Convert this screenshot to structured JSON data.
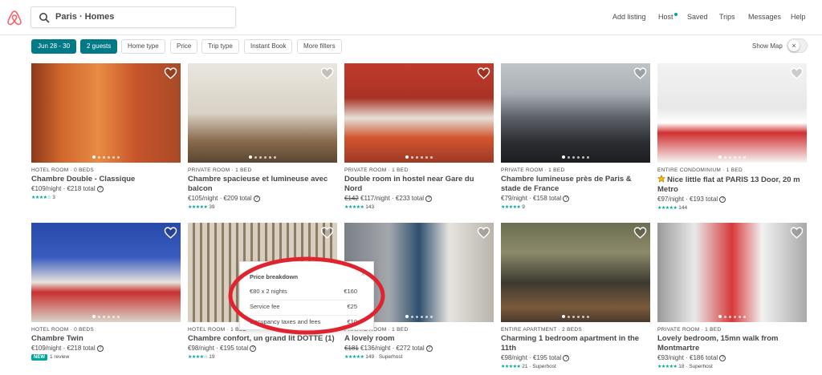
{
  "header": {
    "search_value": "Paris · Homes",
    "nav": [
      "Add listing",
      "Host",
      "Saved",
      "Trips",
      "Messages",
      "Help"
    ]
  },
  "filters": {
    "chips": [
      "Jun 28 - 30",
      "2 guests",
      "Home type",
      "Price",
      "Trip type",
      "Instant Book",
      "More filters"
    ],
    "show_map": "Show Map",
    "toggle_icon": "×"
  },
  "colors": {
    "brand": "#ff5a5f",
    "accent": "#007a87",
    "rating": "#00a699",
    "ellipse": "#e0232f"
  },
  "listings": [
    {
      "kind": "HOTEL ROOM · 0 BEDS",
      "title": "Chambre Double - Classique",
      "price": "€109/night · €218 total",
      "rating_stars": 4,
      "reviews": "3",
      "photo": "orange-hotel"
    },
    {
      "kind": "PRIVATE ROOM · 1 BED",
      "title": "Chambre spacieuse et lumineuse avec balcon",
      "price": "€105/night · €209 total",
      "rating_stars": 5,
      "reviews": "39",
      "photo": "bright-room"
    },
    {
      "kind": "PRIVATE ROOM · 1 BED",
      "title": "Double room in hostel near Gare du Nord",
      "price_old": "€142",
      "price": "€117/night · €233 total",
      "rating_stars": 5,
      "reviews": "143",
      "photo": "red-hostel"
    },
    {
      "kind": "PRIVATE ROOM · 1 BED",
      "title": "Chambre lumineuse près de Paris & stade de France",
      "price": "€79/night · €158 total",
      "rating_stars": 5,
      "reviews": "9",
      "photo": "patterned-bed"
    },
    {
      "kind": "ENTIRE CONDOMINIUM · 1 BED",
      "title": "Nice little flat at PARIS 13 Door, 20 m Metro",
      "price": "€97/night · €193 total",
      "rating_stars": 5,
      "reviews": "144",
      "photo": "white-flat",
      "superhost_star": true
    },
    {
      "kind": "HOTEL ROOM · 0 BEDS",
      "title": "Chambre Twin",
      "price": "€109/night · €218 total",
      "badge": "NEW",
      "reviews": "1 review",
      "photo": "blue-twin"
    },
    {
      "kind": "HOTEL ROOM · 1 BED",
      "title": "Chambre confort, un grand lit DOTTE (1)",
      "price": "€98/night · €195 total",
      "rating_stars": 4,
      "reviews": "19",
      "photo": "striped-room"
    },
    {
      "kind": "PRIVATE ROOM · 1 BED",
      "title": "A lovely room",
      "price_old": "€181",
      "price": "€136/night · €272 total",
      "rating_stars": 5,
      "reviews": "149 · Superhost",
      "photo": "collage"
    },
    {
      "kind": "ENTIRE APARTMENT · 2 BEDS",
      "title": "Charming 1 bedroom apartment in the 11th",
      "price": "€98/night · €195 total",
      "rating_stars": 5,
      "reviews": "21 · Superhost",
      "photo": "living-room"
    },
    {
      "kind": "PRIVATE ROOM · 1 BED",
      "title": "Lovely bedroom, 15mn walk from Montmartre",
      "price": "€93/night · €186 total",
      "rating_stars": 5,
      "reviews": "18 · Superhost",
      "photo": "geisha-curtain"
    }
  ],
  "popup": {
    "title": "Price breakdown",
    "close": "×",
    "rows": [
      {
        "label": "€80 x 2 nights",
        "value": "€160"
      },
      {
        "label": "Service fee",
        "value": "€25"
      },
      {
        "label": "Occupancy taxes and fees",
        "value": "€10"
      }
    ]
  }
}
